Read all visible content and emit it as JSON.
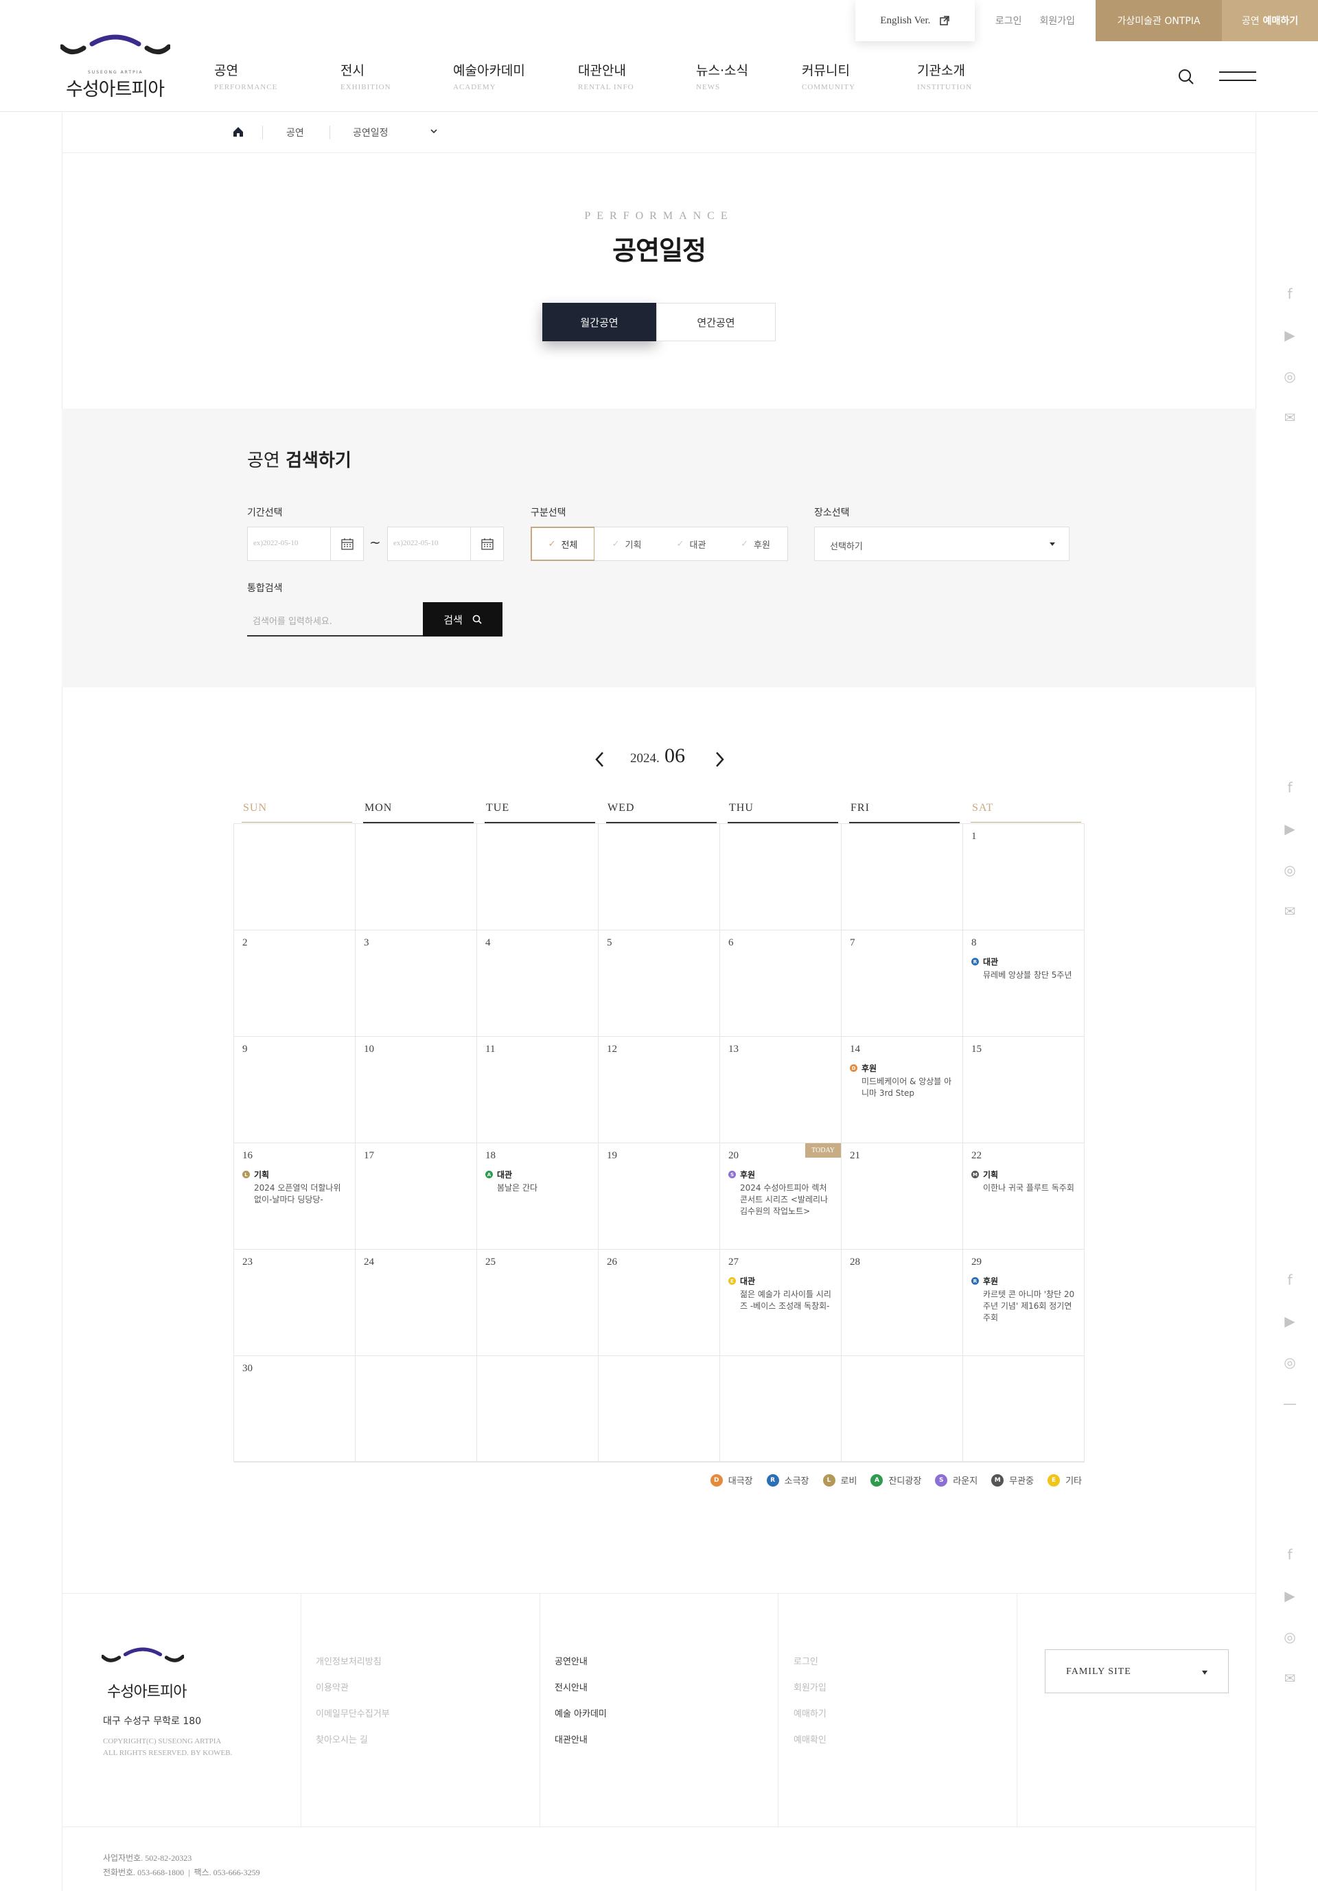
{
  "topbar": {
    "english": "English Ver.",
    "login": "로그인",
    "join": "회원가입",
    "ontpia": "가상미술관 ONTPIA",
    "ticket_a": "공연",
    "ticket_b": "예매하기"
  },
  "logo": {
    "name": "수성아트피아",
    "en": "SUSEONG ARTPIA"
  },
  "gnb": [
    {
      "ko": "공연",
      "en": "PERFORMANCE"
    },
    {
      "ko": "전시",
      "en": "EXHIBITION"
    },
    {
      "ko": "예술아카데미",
      "en": "ACADEMY"
    },
    {
      "ko": "대관안내",
      "en": "RENTAL INFO"
    },
    {
      "ko": "뉴스·소식",
      "en": "NEWS"
    },
    {
      "ko": "커뮤니티",
      "en": "COMMUNITY"
    },
    {
      "ko": "기관소개",
      "en": "INSTITUTION"
    }
  ],
  "breadcrumb": {
    "c1": "공연",
    "c2": "공연일정"
  },
  "page": {
    "en": "PERFORMANCE",
    "ko": "공연일정",
    "tab_monthly": "월간공연",
    "tab_yearly": "연간공연"
  },
  "search": {
    "title_a": "공연",
    "title_b": "검색하기",
    "period_label": "기간선택",
    "date_placeholder": "ex)2022-05-10",
    "tilde": "~",
    "type_label": "구분선택",
    "types": [
      "전체",
      "기획",
      "대관",
      "후원"
    ],
    "place_label": "장소선택",
    "place_value": "선택하기",
    "kw_label": "통합검색",
    "kw_placeholder": "검색어를 입력하세요.",
    "button": "검색"
  },
  "calendar": {
    "year": "2024.",
    "month": "06",
    "days": [
      "SUN",
      "MON",
      "TUE",
      "WED",
      "THU",
      "FRI",
      "SAT"
    ],
    "today_label": "TODAY",
    "weeks": [
      [
        null,
        null,
        null,
        null,
        null,
        null,
        "1"
      ],
      [
        "2",
        "3",
        "4",
        "5",
        "6",
        "7",
        "8"
      ],
      [
        "9",
        "10",
        "11",
        "12",
        "13",
        "14",
        "15"
      ],
      [
        "16",
        "17",
        "18",
        "19",
        "20",
        "21",
        "22"
      ],
      [
        "23",
        "24",
        "25",
        "26",
        "27",
        "28",
        "29"
      ],
      [
        "30",
        null,
        null,
        null,
        null,
        null,
        null
      ]
    ],
    "events": {
      "8": {
        "badge": "R",
        "color": "#2a6fb8",
        "type": "대관",
        "title": "뮤레베 앙상블 창단 5주년"
      },
      "14": {
        "badge": "D",
        "color": "#e58a3a",
        "type": "후원",
        "title": "미드베케이어 & 앙상블 아니마 3rd Step"
      },
      "16": {
        "badge": "L",
        "color": "#b39858",
        "type": "기획",
        "title": "2024 오픈열익 더할나위없이-날마다 딩당당-"
      },
      "18": {
        "badge": "A",
        "color": "#2e9b4e",
        "type": "대관",
        "title": "봄날은 간다"
      },
      "20": {
        "badge": "S",
        "color": "#8c6fd6",
        "type": "후원",
        "title": "2024 수성아트피아 렉처콘서트 시리즈 <발레리나 김수원의 작업노트>"
      },
      "22": {
        "badge": "M",
        "color": "#555555",
        "type": "기획",
        "title": "이한나 귀국 플루트 독주회"
      },
      "27": {
        "badge": "E",
        "color": "#f0c419",
        "type": "대관",
        "title": "젊은 예술가 리사이틀 시리즈 -베이스 조성래 독창회-"
      },
      "29": {
        "badge": "R",
        "color": "#2a6fb8",
        "type": "후원",
        "title": "카르텟 콘 아니마 '창단 20주년 기념' 제16회 정기연주회"
      }
    },
    "legend": [
      {
        "badge": "D",
        "color": "#e58a3a",
        "label": "대극장"
      },
      {
        "badge": "R",
        "color": "#2a6fb8",
        "label": "소극장"
      },
      {
        "badge": "L",
        "color": "#b39858",
        "label": "로비"
      },
      {
        "badge": "A",
        "color": "#2e9b4e",
        "label": "잔디광장"
      },
      {
        "badge": "S",
        "color": "#8c6fd6",
        "label": "라운지"
      },
      {
        "badge": "M",
        "color": "#555555",
        "label": "무관중"
      },
      {
        "badge": "E",
        "color": "#f0c419",
        "label": "기타"
      }
    ]
  },
  "footer": {
    "addr": "대구 수성구 무학로 180",
    "copy1": "COPYRIGHT(C) SUSEONG ARTPIA",
    "copy2": "ALL RIGHTS RESERVED. BY KOWEB.",
    "col1": [
      "개인정보처리방침",
      "이용약관",
      "이메일무단수집거부",
      "찾아오시는 길"
    ],
    "col2": [
      "공연안내",
      "전시안내",
      "예술 아카데미",
      "대관안내"
    ],
    "col3": [
      "로그인",
      "회원가입",
      "예매하기",
      "예매확인"
    ],
    "family": "FAMILY SITE",
    "biz": "사업자번호. 502-82-20323",
    "tel": "전화번호. 053-668-1800",
    "fax": "팩스. 053-666-3259"
  }
}
